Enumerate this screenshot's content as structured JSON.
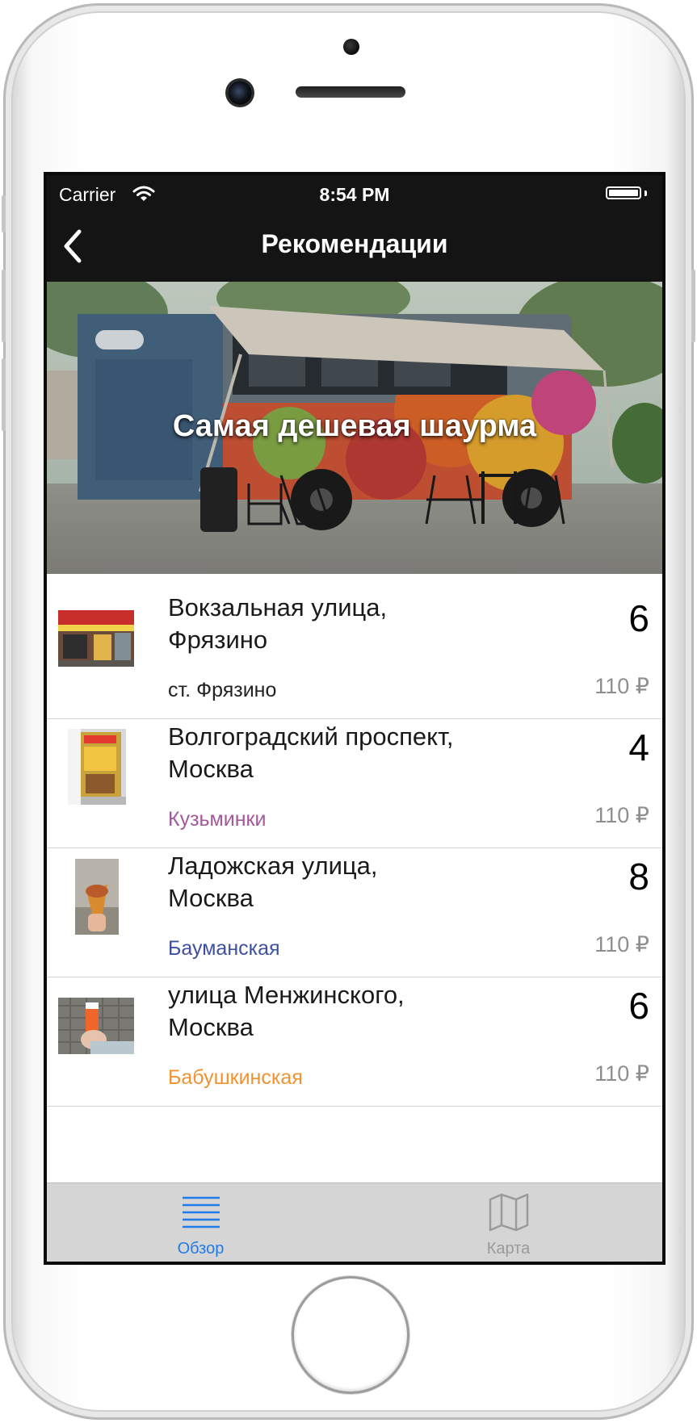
{
  "status_bar": {
    "carrier": "Carrier",
    "time": "8:54 PM"
  },
  "nav_bar": {
    "title": "Рекомендации",
    "back_icon": "chevron-left-icon"
  },
  "banner": {
    "title": "Самая дешевая шаурма"
  },
  "list": {
    "items": [
      {
        "address_line1": "Вокзальная улица,",
        "address_line2": "Фрязино",
        "station": "ст. Фрязино",
        "station_color": "#222222",
        "rating": "6",
        "price": "110 ₽"
      },
      {
        "address_line1": "Волгоградский проспект,",
        "address_line2": "Москва",
        "station": "Кузьминки",
        "station_color": "#a4579b",
        "rating": "4",
        "price": "110 ₽"
      },
      {
        "address_line1": "Ладожская улица,",
        "address_line2": "Москва",
        "station": "Бауманская",
        "station_color": "#3d4fa0",
        "rating": "8",
        "price": "110 ₽"
      },
      {
        "address_line1": "улица Менжинского,",
        "address_line2": "Москва",
        "station": "Бабушкинская",
        "station_color": "#f09330",
        "rating": "6",
        "price": "110 ₽"
      }
    ]
  },
  "tab_bar": {
    "tabs": [
      {
        "label": "Обзор",
        "icon": "list-icon",
        "selected": true,
        "color": "#1f7ce8"
      },
      {
        "label": "Карта",
        "icon": "map-icon",
        "selected": false,
        "color": "#9a9a9a"
      }
    ]
  }
}
